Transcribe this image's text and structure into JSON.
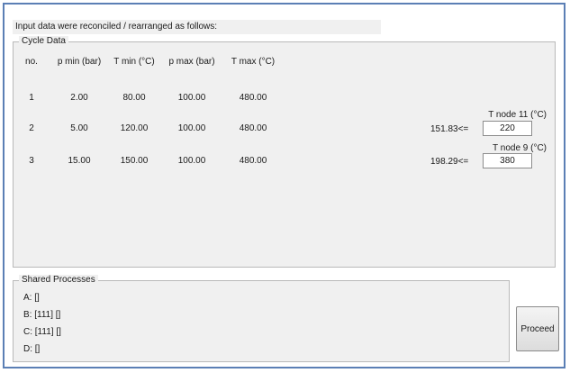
{
  "header": {
    "message": "Input data were reconciled / rearranged as follows:"
  },
  "cycle_data": {
    "title": "Cycle Data",
    "columns": [
      "no.",
      "p min (bar)",
      "T min (°C)",
      "p max (bar)",
      "T max (°C)"
    ],
    "rows": [
      [
        "1",
        "2.00",
        "80.00",
        "100.00",
        "480.00"
      ],
      [
        "2",
        "5.00",
        "120.00",
        "100.00",
        "480.00"
      ],
      [
        "3",
        "15.00",
        "150.00",
        "100.00",
        "480.00"
      ]
    ],
    "nodes": [
      {
        "label": "T node 11 (°C)",
        "bound": "151.83<=",
        "value": "220"
      },
      {
        "label": "T node 9 (°C)",
        "bound": "198.29<=",
        "value": "380"
      }
    ]
  },
  "shared_processes": {
    "title": "Shared Processes",
    "lines": [
      "A: []",
      "B: [111] []",
      "C: [111] []",
      "D: []"
    ]
  },
  "actions": {
    "proceed_label": "Proceed"
  }
}
